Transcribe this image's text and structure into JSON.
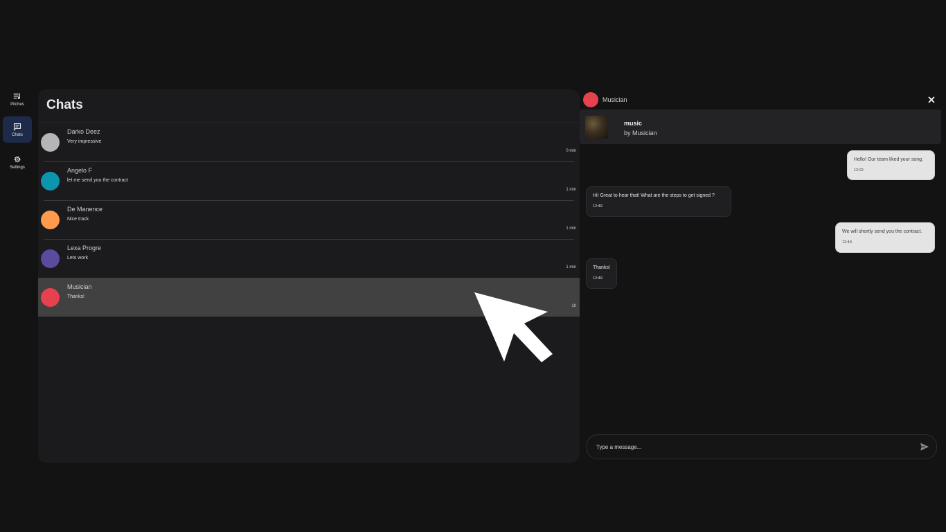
{
  "sidebar": {
    "items": [
      {
        "label": "Pitches",
        "icon": "playlist-icon",
        "active": false
      },
      {
        "label": "Chats",
        "icon": "chat-icon",
        "active": true
      },
      {
        "label": "Settings",
        "icon": "gear-icon",
        "active": false
      }
    ]
  },
  "chats": {
    "title": "Chats",
    "list": [
      {
        "name": "Darko Deez",
        "preview": "Very impressive",
        "time": "0 min",
        "avatar_color": "#b5b5b5"
      },
      {
        "name": "Angelo F",
        "preview": "let me send you the contract",
        "time": "1 min",
        "avatar_color": "#0b96ad"
      },
      {
        "name": "De Manence",
        "preview": "Nice track",
        "time": "1 min",
        "avatar_color": "#ff9a4d"
      },
      {
        "name": "Lexa Progre",
        "preview": "Lets work",
        "time": "1 min",
        "avatar_color": "#5c4a9e"
      },
      {
        "name": "Musician",
        "preview": "Thanks!",
        "time": "1h",
        "avatar_color": "#e5414f"
      }
    ],
    "selected_index": 4
  },
  "conversation": {
    "contact_name": "Musician",
    "contact_color": "#e5414f",
    "pitch": {
      "title": "music",
      "artist": "by Musician"
    },
    "messages": [
      {
        "direction": "out",
        "text": "Hello! Our team liked your song.",
        "time": "12:02"
      },
      {
        "direction": "in",
        "text": "Hi! Great to hear that! What are the steps to get signed ?",
        "time": "12:49"
      },
      {
        "direction": "out",
        "text": "We will shortly send you the contract.",
        "time": "12:49"
      },
      {
        "direction": "in",
        "text": "Thanks!",
        "time": "12:49"
      }
    ],
    "input": {
      "value": "",
      "placeholder": "Type a message..."
    }
  }
}
